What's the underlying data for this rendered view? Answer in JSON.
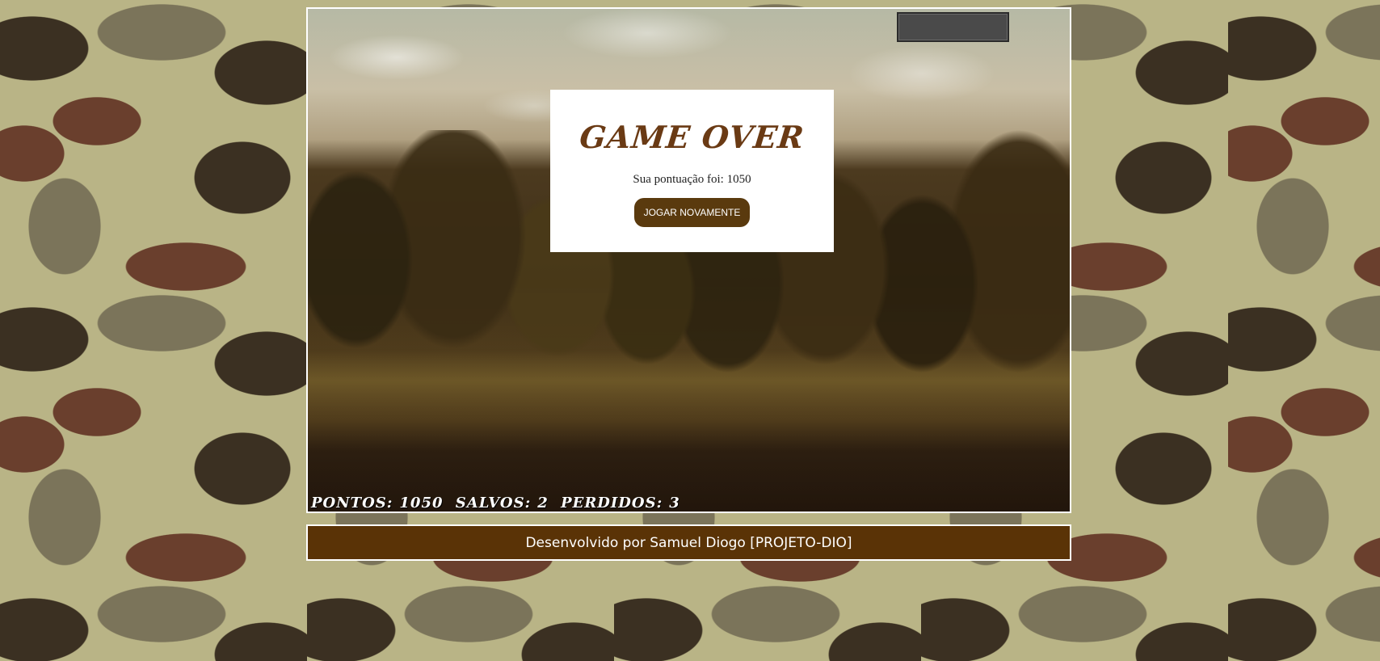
{
  "game": {
    "title": "GAME OVER",
    "score_message": "Sua pontuação foi: 1050",
    "play_again_label": "JOGAR NOVAMENTE",
    "hud": {
      "pontos_label": "PONTOS:",
      "pontos_value": "1050",
      "salvos_label": "SALVOS:",
      "salvos_value": "2",
      "perdidos_label": "PERDIDOS:",
      "perdidos_value": "3"
    }
  },
  "footer": {
    "text": "Desenvolvido por Samuel Diogo [PROJETO-DIO]"
  },
  "colors": {
    "title": "#6a3a14",
    "button": "#5a3a0e",
    "footer": "#5a3306"
  }
}
